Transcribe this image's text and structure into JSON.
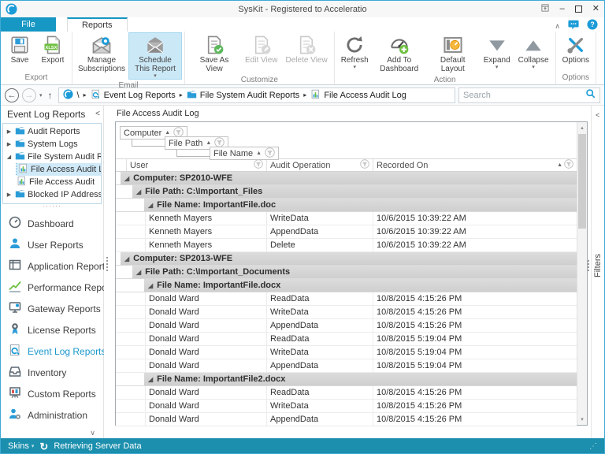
{
  "window": {
    "title": "SysKit - Registered to Acceleratio"
  },
  "tabs": {
    "file": "File",
    "reports": "Reports"
  },
  "ribbon": {
    "groups": [
      {
        "label": "Export",
        "buttons": [
          {
            "label": "Save",
            "icon": "save"
          },
          {
            "label": "Export",
            "icon": "export"
          }
        ]
      },
      {
        "label": "Email",
        "buttons": [
          {
            "label": "Manage Subscriptions",
            "icon": "envelope-gear"
          },
          {
            "label": "Schedule This Report",
            "icon": "envelope",
            "highlighted": true,
            "dropdown": true
          }
        ]
      },
      {
        "label": "Customize",
        "buttons": [
          {
            "label": "Save As View",
            "icon": "doc-check"
          },
          {
            "label": "Edit View",
            "icon": "doc-edit",
            "disabled": true
          },
          {
            "label": "Delete View",
            "icon": "doc-delete",
            "disabled": true
          }
        ]
      },
      {
        "label": "Action",
        "buttons": [
          {
            "label": "Refresh",
            "icon": "refresh",
            "dropdown": true
          },
          {
            "label": "Add To Dashboard",
            "icon": "gauge-plus"
          },
          {
            "label": "Default Layout",
            "icon": "layout"
          },
          {
            "label": "Expand",
            "icon": "triangle-down",
            "dropdown": true
          },
          {
            "label": "Collapse",
            "icon": "triangle-up",
            "dropdown": true
          }
        ]
      },
      {
        "label": "Options",
        "buttons": [
          {
            "label": "Options",
            "icon": "tools"
          }
        ]
      }
    ]
  },
  "addressbar": {
    "breadcrumb": [
      {
        "label": "Event Log Reports",
        "icon": "eventlog"
      },
      {
        "label": "File System Audit Reports",
        "icon": "folder"
      },
      {
        "label": "File Access Audit Log",
        "icon": "report"
      }
    ],
    "root": "\\",
    "search_placeholder": "Search"
  },
  "sidebar": {
    "header": "Event Log Reports",
    "collapse_glyph": "<",
    "tree": [
      {
        "label": "Audit Reports",
        "icon": "folder",
        "state": "collapsed"
      },
      {
        "label": "System Logs",
        "icon": "folder",
        "state": "collapsed"
      },
      {
        "label": "File System Audit Reports",
        "icon": "folder",
        "state": "expanded"
      },
      {
        "label": "File Access Audit Log",
        "icon": "report",
        "child": true,
        "selected": true
      },
      {
        "label": "File Access Audit",
        "icon": "report",
        "child": true
      },
      {
        "label": "Blocked IP Addresses",
        "icon": "folder",
        "state": "collapsed"
      }
    ],
    "nav": [
      {
        "label": "Dashboard",
        "icon": "dashboard"
      },
      {
        "label": "User Reports",
        "icon": "user"
      },
      {
        "label": "Application Reports",
        "icon": "application"
      },
      {
        "label": "Performance Reports",
        "icon": "performance"
      },
      {
        "label": "Gateway Reports",
        "icon": "gateway"
      },
      {
        "label": "License Reports",
        "icon": "license"
      },
      {
        "label": "Event Log Reports",
        "icon": "eventlog",
        "active": true
      },
      {
        "label": "Inventory",
        "icon": "inventory"
      },
      {
        "label": "Custom Reports",
        "icon": "custom"
      },
      {
        "label": "Administration",
        "icon": "admin"
      }
    ]
  },
  "main": {
    "tab_title": "File Access Audit Log",
    "groupby": [
      {
        "label": "Computer"
      },
      {
        "label": "File Path"
      },
      {
        "label": "File Name"
      }
    ],
    "columns": {
      "user": "User",
      "operation": "Audit Operation",
      "recorded": "Recorded On"
    },
    "rows": [
      {
        "type": "group",
        "level": 0,
        "label": "Computer: SP2010-WFE"
      },
      {
        "type": "group",
        "level": 1,
        "label": "File Path: C:\\Important_Files"
      },
      {
        "type": "group",
        "level": 2,
        "label": "File Name: ImportantFile.doc"
      },
      {
        "type": "data",
        "user": "Kenneth Mayers",
        "operation": "WriteData",
        "recorded": "10/6/2015 10:39:22 AM"
      },
      {
        "type": "data",
        "user": "Kenneth Mayers",
        "operation": "AppendData",
        "recorded": "10/6/2015 10:39:22 AM"
      },
      {
        "type": "data",
        "user": "Kenneth Mayers",
        "operation": "Delete",
        "recorded": "10/6/2015 10:39:22 AM"
      },
      {
        "type": "group",
        "level": 0,
        "label": "Computer: SP2013-WFE"
      },
      {
        "type": "group",
        "level": 1,
        "label": "File Path: C:\\Important_Documents"
      },
      {
        "type": "group",
        "level": 2,
        "label": "File Name: ImportantFile.docx"
      },
      {
        "type": "data",
        "user": "Donald Ward",
        "operation": "ReadData",
        "recorded": "10/8/2015 4:15:26 PM"
      },
      {
        "type": "data",
        "user": "Donald Ward",
        "operation": "WriteData",
        "recorded": "10/8/2015 4:15:26 PM"
      },
      {
        "type": "data",
        "user": "Donald Ward",
        "operation": "AppendData",
        "recorded": "10/8/2015 4:15:26 PM"
      },
      {
        "type": "data",
        "user": "Donald Ward",
        "operation": "ReadData",
        "recorded": "10/8/2015 5:19:04 PM"
      },
      {
        "type": "data",
        "user": "Donald Ward",
        "operation": "WriteData",
        "recorded": "10/8/2015 5:19:04 PM"
      },
      {
        "type": "data",
        "user": "Donald Ward",
        "operation": "AppendData",
        "recorded": "10/8/2015 5:19:04 PM"
      },
      {
        "type": "group",
        "level": 2,
        "label": "File Name: ImportantFile2.docx"
      },
      {
        "type": "data",
        "user": "Donald Ward",
        "operation": "ReadData",
        "recorded": "10/8/2015 4:15:26 PM"
      },
      {
        "type": "data",
        "user": "Donald Ward",
        "operation": "WriteData",
        "recorded": "10/8/2015 4:15:26 PM"
      },
      {
        "type": "data",
        "user": "Donald Ward",
        "operation": "AppendData",
        "recorded": "10/8/2015 4:15:26 PM"
      }
    ]
  },
  "filters_panel": {
    "label": "Filters"
  },
  "statusbar": {
    "skins": "Skins",
    "status": "Retrieving Server Data"
  },
  "colors": {
    "accent": "#1797c4",
    "statusbar": "#1b8fad",
    "highlight": "#cbe8f6",
    "group_row": "#d5d5d5"
  }
}
